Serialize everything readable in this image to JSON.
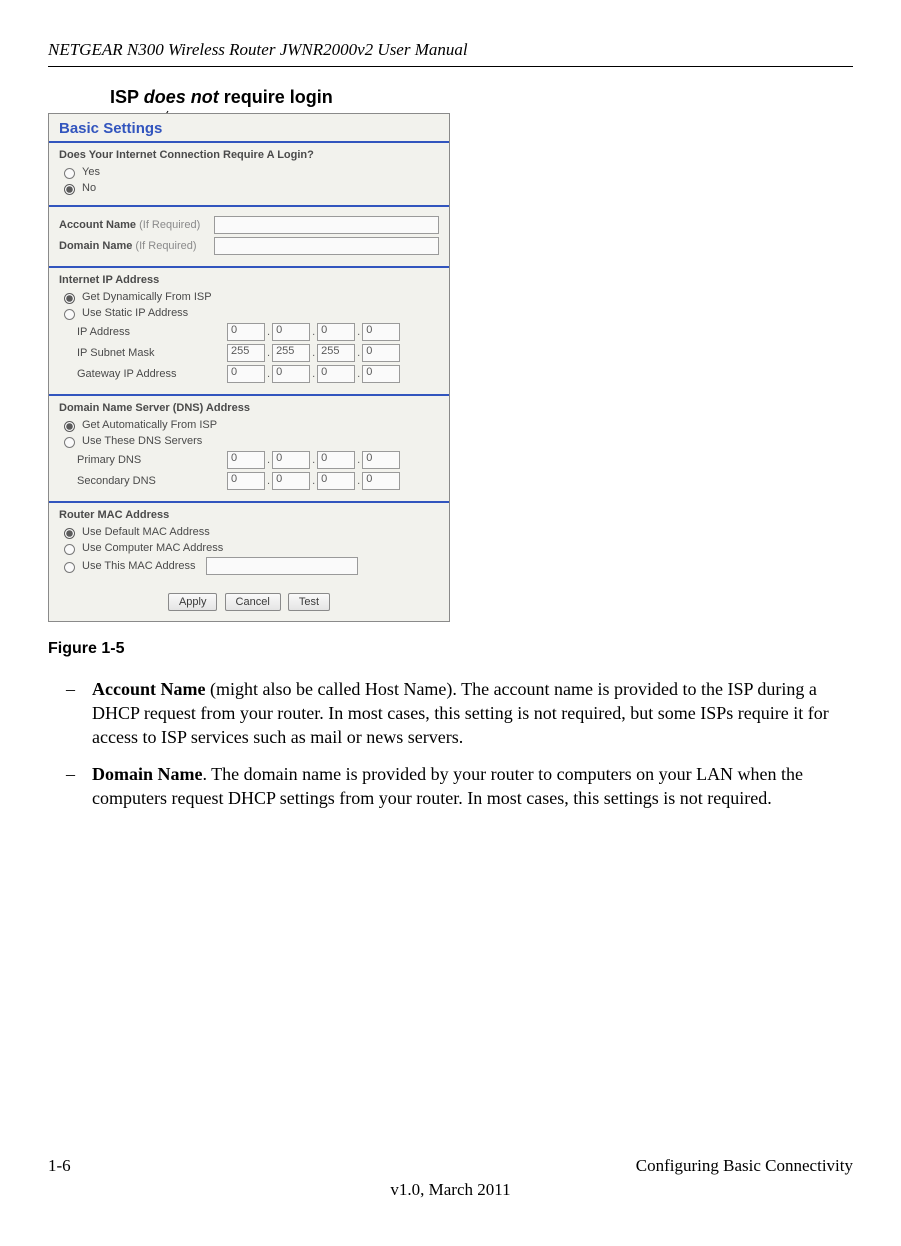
{
  "header": {
    "running_title": "NETGEAR N300 Wireless Router JWNR2000v2 User Manual"
  },
  "callout": {
    "pre": "ISP ",
    "em": "does not",
    "post": " require login"
  },
  "router": {
    "title": "Basic Settings",
    "login_q": "Does Your Internet Connection Require A Login?",
    "yes": "Yes",
    "no": "No",
    "acct_label": "Account Name",
    "acct_dim": "(If Required)",
    "domain_label": "Domain Name",
    "domain_dim": "(If Required)",
    "ip_heading": "Internet IP Address",
    "ip_opt1": "Get Dynamically From ISP",
    "ip_opt2": "Use Static IP Address",
    "ip_addr_label": "IP Address",
    "ip_mask_label": "IP Subnet Mask",
    "ip_gw_label": "Gateway IP Address",
    "ip_addr": [
      "0",
      "0",
      "0",
      "0"
    ],
    "ip_mask": [
      "255",
      "255",
      "255",
      "0"
    ],
    "ip_gw": [
      "0",
      "0",
      "0",
      "0"
    ],
    "dns_heading": "Domain Name Server (DNS) Address",
    "dns_opt1": "Get Automatically From ISP",
    "dns_opt2": "Use These DNS Servers",
    "dns_p_label": "Primary DNS",
    "dns_s_label": "Secondary DNS",
    "dns_p": [
      "0",
      "0",
      "0",
      "0"
    ],
    "dns_s": [
      "0",
      "0",
      "0",
      "0"
    ],
    "mac_heading": "Router MAC Address",
    "mac_opt1": "Use Default MAC Address",
    "mac_opt2": "Use Computer MAC Address",
    "mac_opt3": "Use This MAC Address",
    "btn_apply": "Apply",
    "btn_cancel": "Cancel",
    "btn_test": "Test"
  },
  "figure_caption": "Figure 1-5",
  "items": {
    "acct": {
      "lead": "Account Name",
      "text": " (might also be called Host Name). The account name is provided to the ISP during a DHCP request from your router. In most cases, this setting is not required, but some ISPs require it for access to ISP services such as mail or news servers."
    },
    "dom": {
      "lead": "Domain Name",
      "text": ". The domain name is provided by your router to computers on your LAN when the computers request DHCP settings from your router. In most cases, this settings is not required."
    }
  },
  "footer": {
    "page_num": "1-6",
    "chapter": "Configuring Basic Connectivity",
    "version": "v1.0, March 2011"
  }
}
